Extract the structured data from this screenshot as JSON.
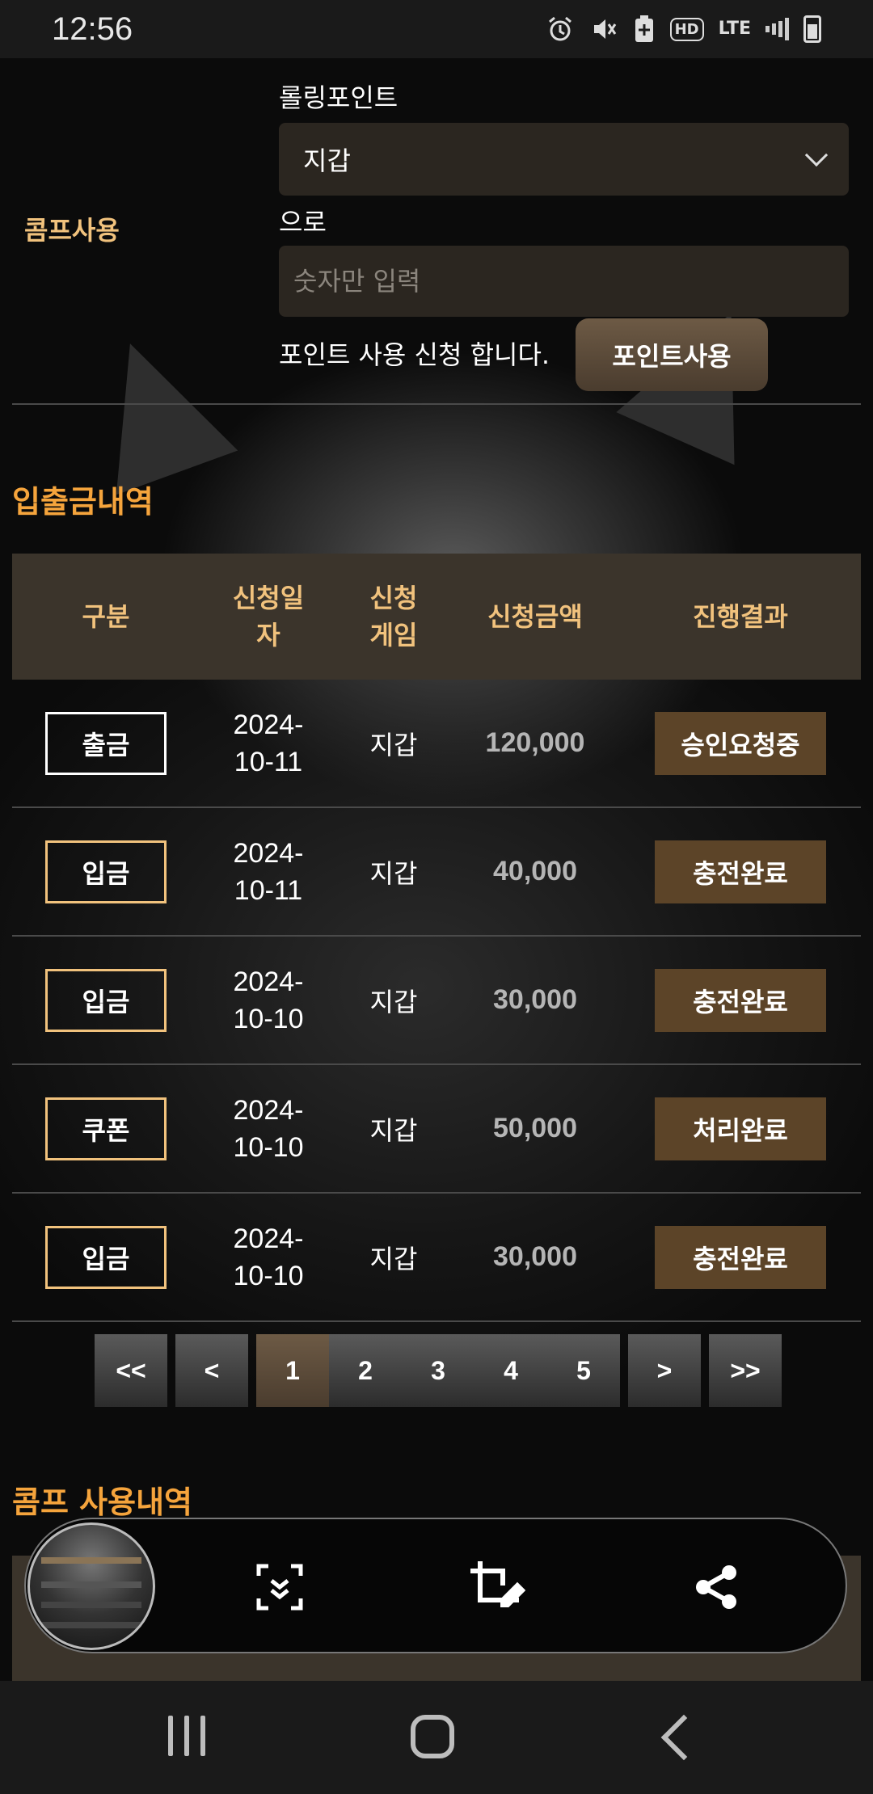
{
  "status_bar": {
    "time": "12:56",
    "icons": [
      "alarm-icon",
      "mute-icon",
      "battery-saver-icon",
      "hd-icon",
      "lte-icon",
      "signal-icon",
      "battery-icon"
    ],
    "hd": "HD",
    "lte": "LTE"
  },
  "comp_form": {
    "label": "콤프사용",
    "rolling_label": "롤링포인트",
    "wallet_select": "지갑",
    "to_label": "으로",
    "amount_placeholder": "숫자만 입력",
    "apply_text": "포인트 사용 신청 합니다.",
    "button": "포인트사용"
  },
  "deposit_history": {
    "title": "입출금내역",
    "headers": [
      "구분",
      "신청일\n자",
      "신청\n게임",
      "신청금액",
      "진행결과"
    ],
    "rows": [
      {
        "type": "출금",
        "date": "2024-\n10-11",
        "game": "지갑",
        "amount": "120,000",
        "result": "승인요청중"
      },
      {
        "type": "입금",
        "date": "2024-\n10-11",
        "game": "지갑",
        "amount": "40,000",
        "result": "충전완료"
      },
      {
        "type": "입금",
        "date": "2024-\n10-10",
        "game": "지갑",
        "amount": "30,000",
        "result": "충전완료"
      },
      {
        "type": "쿠폰",
        "date": "2024-\n10-10",
        "game": "지갑",
        "amount": "50,000",
        "result": "처리완료"
      },
      {
        "type": "입금",
        "date": "2024-\n10-10",
        "game": "지갑",
        "amount": "30,000",
        "result": "충전완료"
      }
    ]
  },
  "pagination": {
    "first": "<<",
    "prev": "<",
    "pages": [
      "1",
      "2",
      "3",
      "4",
      "5"
    ],
    "current": "1",
    "next": ">",
    "last": ">>"
  },
  "comp_history": {
    "title": "콤프 사용내역"
  },
  "screenshot_toolbar": {
    "tools": [
      "scroll-capture-icon",
      "crop-edit-icon",
      "share-icon"
    ]
  },
  "colors": {
    "accent_orange": "#f5a43c",
    "gold": "#f1c27d",
    "brown_button": "#5c4428",
    "header_bg": "#3b342b"
  }
}
